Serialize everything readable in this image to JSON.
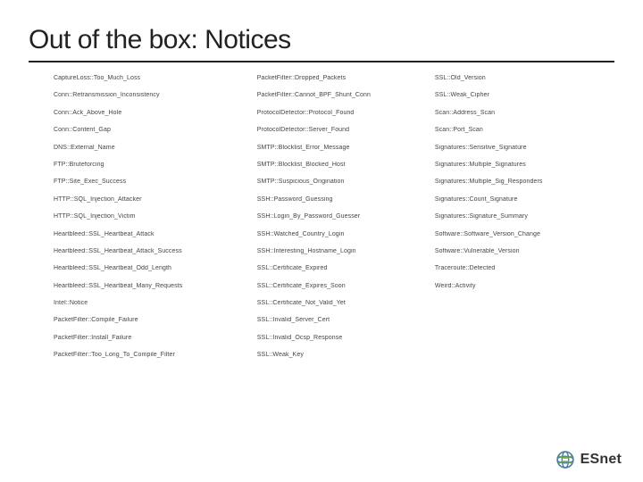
{
  "title": "Out of the box: Notices",
  "brand": {
    "name": "ESnet"
  },
  "col1": [
    "CaptureLoss::Too_Much_Loss",
    "Conn::Retransmission_Inconsistency",
    "Conn::Ack_Above_Hole",
    "Conn::Content_Gap",
    "DNS::External_Name",
    "FTP::Bruteforcing",
    "FTP::Site_Exec_Success",
    "HTTP::SQL_Injection_Attacker",
    "HTTP::SQL_Injection_Victim",
    "Heartbleed::SSL_Heartbeat_Attack",
    "Heartbleed::SSL_Heartbeat_Attack_Success",
    "Heartbleed::SSL_Heartbeat_Odd_Length",
    "Heartbleed::SSL_Heartbeat_Many_Requests",
    "Intel::Notice",
    "PacketFilter::Compile_Failure",
    "PacketFilter::Install_Failure",
    "PacketFilter::Too_Long_To_Compile_Filter"
  ],
  "col2": [
    "PacketFilter::Dropped_Packets",
    "PacketFilter::Cannot_BPF_Shunt_Conn",
    "ProtocolDetector::Protocol_Found",
    "ProtocolDetector::Server_Found",
    "SMTP::Blocklist_Error_Message",
    "SMTP::Blocklist_Blocked_Host",
    "SMTP::Suspicious_Origination",
    "SSH::Password_Guessing",
    "SSH::Login_By_Password_Guesser",
    "SSH::Watched_Country_Login",
    "SSH::Interesting_Hostname_Login",
    "SSL::Certificate_Expired",
    "SSL::Certificate_Expires_Soon",
    "SSL::Certificate_Not_Valid_Yet",
    "SSL::Invalid_Server_Cert",
    "SSL::Invalid_Ocsp_Response",
    "SSL::Weak_Key"
  ],
  "col3": [
    "SSL::Old_Version",
    "SSL::Weak_Cipher",
    "Scan::Address_Scan",
    "Scan::Port_Scan",
    "Signatures::Sensitive_Signature",
    "Signatures::Multiple_Signatures",
    "Signatures::Multiple_Sig_Responders",
    "Signatures::Count_Signature",
    "Signatures::Signature_Summary",
    "Software::Software_Version_Change",
    "Software::Vulnerable_Version",
    "Traceroute::Detected",
    "Weird::Activity"
  ]
}
